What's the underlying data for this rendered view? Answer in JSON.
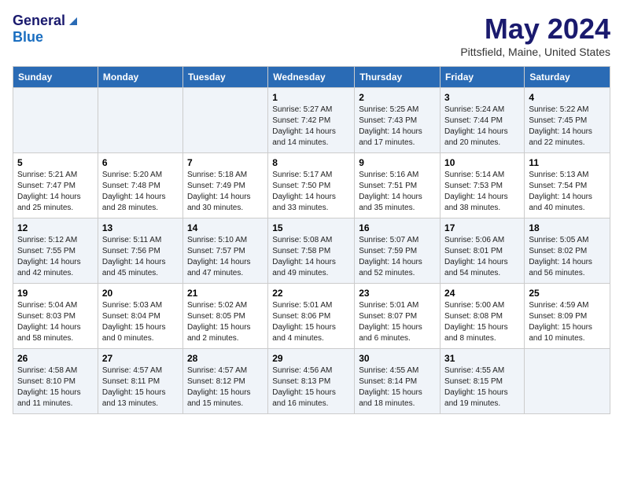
{
  "header": {
    "logo_general": "General",
    "logo_blue": "Blue",
    "title": "May 2024",
    "location": "Pittsfield, Maine, United States"
  },
  "calendar": {
    "days_of_week": [
      "Sunday",
      "Monday",
      "Tuesday",
      "Wednesday",
      "Thursday",
      "Friday",
      "Saturday"
    ],
    "weeks": [
      [
        {
          "day": "",
          "detail": ""
        },
        {
          "day": "",
          "detail": ""
        },
        {
          "day": "",
          "detail": ""
        },
        {
          "day": "1",
          "detail": "Sunrise: 5:27 AM\nSunset: 7:42 PM\nDaylight: 14 hours and 14 minutes."
        },
        {
          "day": "2",
          "detail": "Sunrise: 5:25 AM\nSunset: 7:43 PM\nDaylight: 14 hours and 17 minutes."
        },
        {
          "day": "3",
          "detail": "Sunrise: 5:24 AM\nSunset: 7:44 PM\nDaylight: 14 hours and 20 minutes."
        },
        {
          "day": "4",
          "detail": "Sunrise: 5:22 AM\nSunset: 7:45 PM\nDaylight: 14 hours and 22 minutes."
        }
      ],
      [
        {
          "day": "5",
          "detail": "Sunrise: 5:21 AM\nSunset: 7:47 PM\nDaylight: 14 hours and 25 minutes."
        },
        {
          "day": "6",
          "detail": "Sunrise: 5:20 AM\nSunset: 7:48 PM\nDaylight: 14 hours and 28 minutes."
        },
        {
          "day": "7",
          "detail": "Sunrise: 5:18 AM\nSunset: 7:49 PM\nDaylight: 14 hours and 30 minutes."
        },
        {
          "day": "8",
          "detail": "Sunrise: 5:17 AM\nSunset: 7:50 PM\nDaylight: 14 hours and 33 minutes."
        },
        {
          "day": "9",
          "detail": "Sunrise: 5:16 AM\nSunset: 7:51 PM\nDaylight: 14 hours and 35 minutes."
        },
        {
          "day": "10",
          "detail": "Sunrise: 5:14 AM\nSunset: 7:53 PM\nDaylight: 14 hours and 38 minutes."
        },
        {
          "day": "11",
          "detail": "Sunrise: 5:13 AM\nSunset: 7:54 PM\nDaylight: 14 hours and 40 minutes."
        }
      ],
      [
        {
          "day": "12",
          "detail": "Sunrise: 5:12 AM\nSunset: 7:55 PM\nDaylight: 14 hours and 42 minutes."
        },
        {
          "day": "13",
          "detail": "Sunrise: 5:11 AM\nSunset: 7:56 PM\nDaylight: 14 hours and 45 minutes."
        },
        {
          "day": "14",
          "detail": "Sunrise: 5:10 AM\nSunset: 7:57 PM\nDaylight: 14 hours and 47 minutes."
        },
        {
          "day": "15",
          "detail": "Sunrise: 5:08 AM\nSunset: 7:58 PM\nDaylight: 14 hours and 49 minutes."
        },
        {
          "day": "16",
          "detail": "Sunrise: 5:07 AM\nSunset: 7:59 PM\nDaylight: 14 hours and 52 minutes."
        },
        {
          "day": "17",
          "detail": "Sunrise: 5:06 AM\nSunset: 8:01 PM\nDaylight: 14 hours and 54 minutes."
        },
        {
          "day": "18",
          "detail": "Sunrise: 5:05 AM\nSunset: 8:02 PM\nDaylight: 14 hours and 56 minutes."
        }
      ],
      [
        {
          "day": "19",
          "detail": "Sunrise: 5:04 AM\nSunset: 8:03 PM\nDaylight: 14 hours and 58 minutes."
        },
        {
          "day": "20",
          "detail": "Sunrise: 5:03 AM\nSunset: 8:04 PM\nDaylight: 15 hours and 0 minutes."
        },
        {
          "day": "21",
          "detail": "Sunrise: 5:02 AM\nSunset: 8:05 PM\nDaylight: 15 hours and 2 minutes."
        },
        {
          "day": "22",
          "detail": "Sunrise: 5:01 AM\nSunset: 8:06 PM\nDaylight: 15 hours and 4 minutes."
        },
        {
          "day": "23",
          "detail": "Sunrise: 5:01 AM\nSunset: 8:07 PM\nDaylight: 15 hours and 6 minutes."
        },
        {
          "day": "24",
          "detail": "Sunrise: 5:00 AM\nSunset: 8:08 PM\nDaylight: 15 hours and 8 minutes."
        },
        {
          "day": "25",
          "detail": "Sunrise: 4:59 AM\nSunset: 8:09 PM\nDaylight: 15 hours and 10 minutes."
        }
      ],
      [
        {
          "day": "26",
          "detail": "Sunrise: 4:58 AM\nSunset: 8:10 PM\nDaylight: 15 hours and 11 minutes."
        },
        {
          "day": "27",
          "detail": "Sunrise: 4:57 AM\nSunset: 8:11 PM\nDaylight: 15 hours and 13 minutes."
        },
        {
          "day": "28",
          "detail": "Sunrise: 4:57 AM\nSunset: 8:12 PM\nDaylight: 15 hours and 15 minutes."
        },
        {
          "day": "29",
          "detail": "Sunrise: 4:56 AM\nSunset: 8:13 PM\nDaylight: 15 hours and 16 minutes."
        },
        {
          "day": "30",
          "detail": "Sunrise: 4:55 AM\nSunset: 8:14 PM\nDaylight: 15 hours and 18 minutes."
        },
        {
          "day": "31",
          "detail": "Sunrise: 4:55 AM\nSunset: 8:15 PM\nDaylight: 15 hours and 19 minutes."
        },
        {
          "day": "",
          "detail": ""
        }
      ]
    ]
  }
}
